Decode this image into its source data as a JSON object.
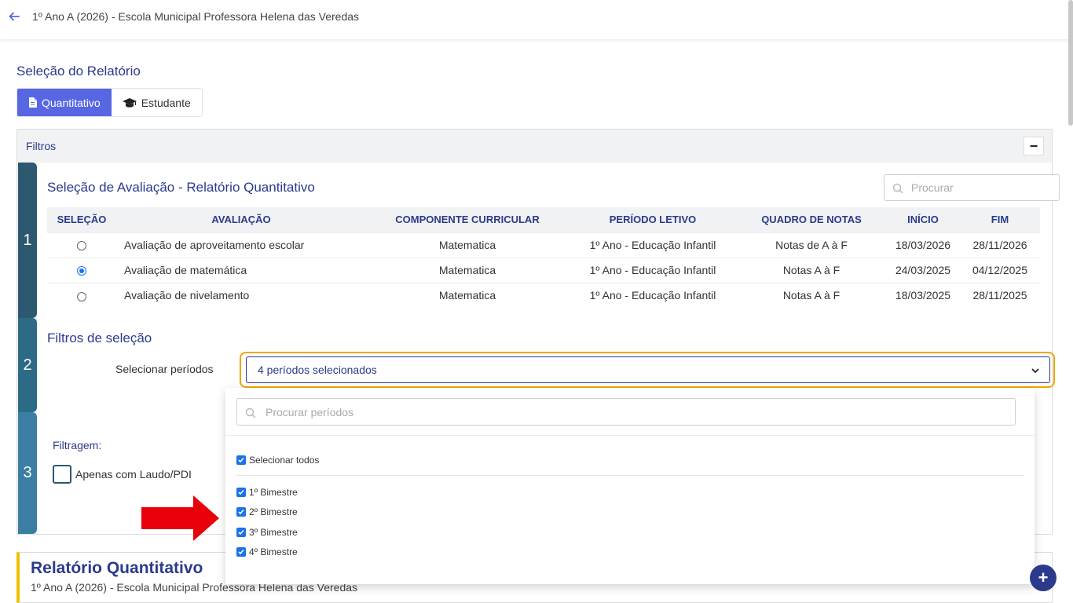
{
  "header": {
    "title": "1º Ano A (2026) - Escola Municipal Professora Helena das Veredas"
  },
  "selection": {
    "title": "Seleção do Relatório",
    "tabs": [
      {
        "label": "Quantitativo",
        "icon": "document-icon",
        "active": true
      },
      {
        "label": "Estudante",
        "icon": "graduation-cap-icon",
        "active": false
      }
    ]
  },
  "filters": {
    "label": "Filtros",
    "collapse_symbol": "−",
    "steps": [
      "1",
      "2",
      "3"
    ],
    "evaluation": {
      "title": "Seleção de Avaliação - Relatório Quantitativo",
      "search_placeholder": "Procurar",
      "columns": [
        "SELEÇÃO",
        "AVALIAÇÃO",
        "COMPONENTE CURRICULAR",
        "PERÍODO LETIVO",
        "QUADRO DE NOTAS",
        "INÍCIO",
        "FIM"
      ],
      "rows": [
        {
          "selected": false,
          "avaliacao": "Avaliação de aproveitamento escolar",
          "componente": "Matematica",
          "periodo": "1º Ano - Educação Infantil",
          "quadro": "Notas de A à F",
          "inicio": "18/03/2026",
          "fim": "28/11/2026"
        },
        {
          "selected": true,
          "avaliacao": "Avaliação de matemática",
          "componente": "Matematica",
          "periodo": "1º Ano - Educação Infantil",
          "quadro": "Notas A à F",
          "inicio": "24/03/2025",
          "fim": "04/12/2025"
        },
        {
          "selected": false,
          "avaliacao": "Avaliação de nivelamento",
          "componente": "Matematica",
          "periodo": "1º Ano - Educação Infantil",
          "quadro": "Notas A à F",
          "inicio": "18/03/2025",
          "fim": "28/11/2025"
        }
      ]
    },
    "selection_filters": {
      "title": "Filtros de seleção",
      "periods_label": "Selecionar períodos",
      "periods_value": "4 períodos selecionados"
    },
    "filtering": {
      "title": "Filtragem:",
      "laudo_label": "Apenas com Laudo/PDI",
      "laudo_checked": false
    }
  },
  "dropdown": {
    "search_placeholder": "Procurar períodos",
    "select_all": "Selecionar todos",
    "options": [
      "1º Bimestre",
      "2º Bimestre",
      "3º Bimestre",
      "4º Bimestre"
    ]
  },
  "report": {
    "title": "Relatório Quantitativo",
    "subtitle": "1º Ano A (2026) - Escola Municipal Professora Helena das Veredas"
  },
  "fab": {
    "symbol": "+"
  },
  "colors": {
    "accent": "#5767e4",
    "navy": "#2b3a8c",
    "highlight": "#f0a500",
    "arrow": "#e8000b"
  }
}
